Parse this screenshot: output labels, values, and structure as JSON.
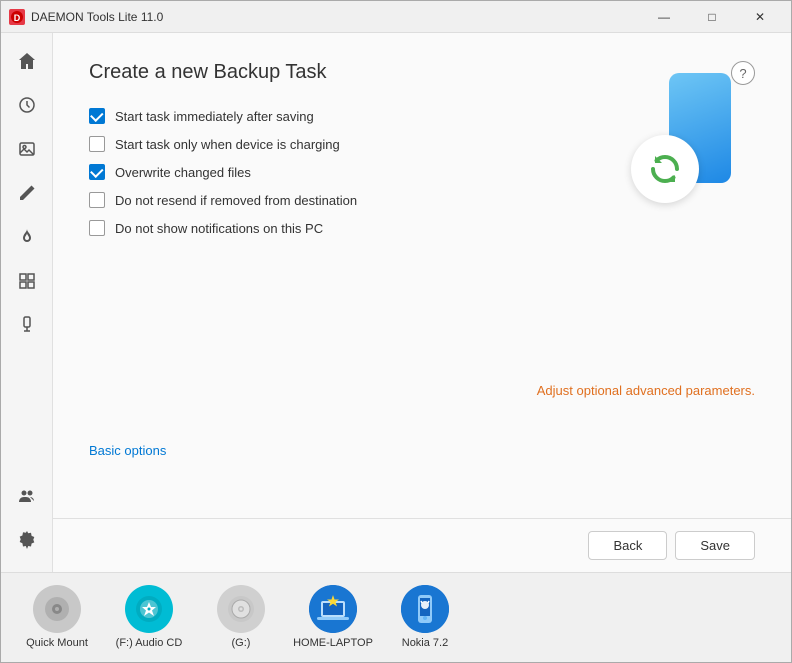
{
  "window": {
    "title": "DAEMON Tools Lite 11.0",
    "icon": "DT"
  },
  "title_bar": {
    "minimize_label": "—",
    "maximize_label": "□",
    "close_label": "✕"
  },
  "page": {
    "title": "Create a new Backup Task",
    "help_symbol": "?",
    "advanced_params_text": "Adjust optional advanced parameters.",
    "basic_options_label": "Basic options",
    "back_label": "Back",
    "save_label": "Save"
  },
  "checkboxes": [
    {
      "id": "cb1",
      "label": "Start task immediately after saving",
      "checked": true
    },
    {
      "id": "cb2",
      "label": "Start task only when device is charging",
      "checked": false
    },
    {
      "id": "cb3",
      "label": "Overwrite changed files",
      "checked": true
    },
    {
      "id": "cb4",
      "label": "Do not resend if removed from destination",
      "checked": false
    },
    {
      "id": "cb5",
      "label": "Do not show notifications on this PC",
      "checked": false
    }
  ],
  "sidebar": {
    "items": [
      {
        "name": "home",
        "icon": "⌂"
      },
      {
        "name": "clock",
        "icon": "◎"
      },
      {
        "name": "image",
        "icon": "⊡"
      },
      {
        "name": "edit",
        "icon": "✏"
      },
      {
        "name": "fire",
        "icon": "🔥"
      },
      {
        "name": "scan",
        "icon": "⊞"
      },
      {
        "name": "usb",
        "icon": "⚡"
      }
    ]
  },
  "taskbar": {
    "items": [
      {
        "id": "quick-mount",
        "label": "Quick Mount",
        "icon_type": "quick-mount"
      },
      {
        "id": "audio-cd",
        "label": "(F:) Audio CD",
        "icon_type": "audio-cd"
      },
      {
        "id": "g-drive",
        "label": "(G:)",
        "icon_type": "g-drive"
      },
      {
        "id": "home-laptop",
        "label": "HOME-LAPTOP",
        "icon_type": "home-laptop"
      },
      {
        "id": "nokia",
        "label": "Nokia 7.2",
        "icon_type": "nokia"
      }
    ]
  },
  "bottom_sidebar": {
    "items": [
      {
        "name": "people",
        "icon": "👥"
      },
      {
        "name": "settings",
        "icon": "⚙"
      }
    ]
  }
}
